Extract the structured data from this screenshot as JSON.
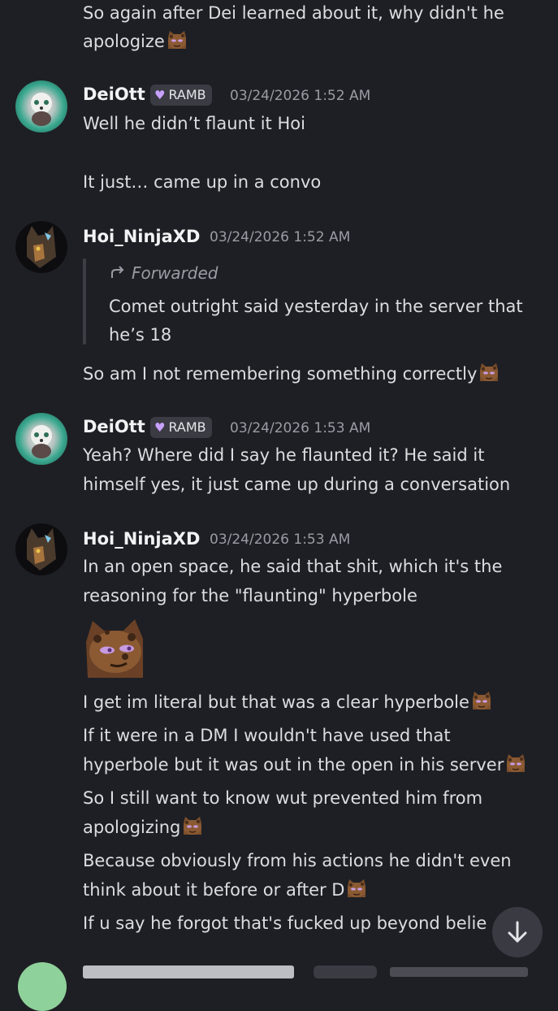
{
  "messages": {
    "top": {
      "line1": "So again after Dei learned about it, why didn't he",
      "line2": "apologize"
    },
    "m1": {
      "author": "DeiOtt",
      "tag": "RAMB",
      "time": "03/24/2026 1:52 AM",
      "line1": "Well he didn’t flaunt it Hoi",
      "line2": "It just… came up in a convo"
    },
    "m2": {
      "author": "Hoi_NinjaXD",
      "time": "03/24/2026 1:52 AM",
      "forward_label": "Forwarded",
      "forward_line1": "Comet outright said yesterday in the server that",
      "forward_line2": "he’s 18",
      "line1": "So am I not remembering something correctly"
    },
    "m3": {
      "author": "DeiOtt",
      "tag": "RAMB",
      "time": "03/24/2026 1:53 AM",
      "line1": "Yeah? Where did I say he flaunted it? He said it",
      "line2": "himself yes, it just came up during a conversation"
    },
    "m4": {
      "author": "Hoi_NinjaXD",
      "time": "03/24/2026 1:53 AM",
      "line1": "In an open space, he said that shit, which it's the",
      "line2": "reasoning for the \"flaunting\" hyperbole",
      "line3": "I get im literal but that was a clear hyperbole",
      "line4": "If it were in a DM I wouldn't have used that",
      "line5": "hyperbole but it was out in the open in his server",
      "line6": "So I still want to know wut prevented him from",
      "line7": "apologizing",
      "line8": "Because obviously from his actions he didn't even",
      "line9": "think about it before or after D",
      "line10": "If u say he forgot that's fucked up beyond belie"
    }
  },
  "icons": {
    "forward": "forward-arrow-icon",
    "scroll": "arrow-down-icon",
    "emoji": "emoji-face-icon"
  },
  "colors": {
    "background": "#1e1f24",
    "text": "#dbdee1",
    "muted": "#9a9ca5",
    "tag_heart": "#c8a1ff"
  }
}
